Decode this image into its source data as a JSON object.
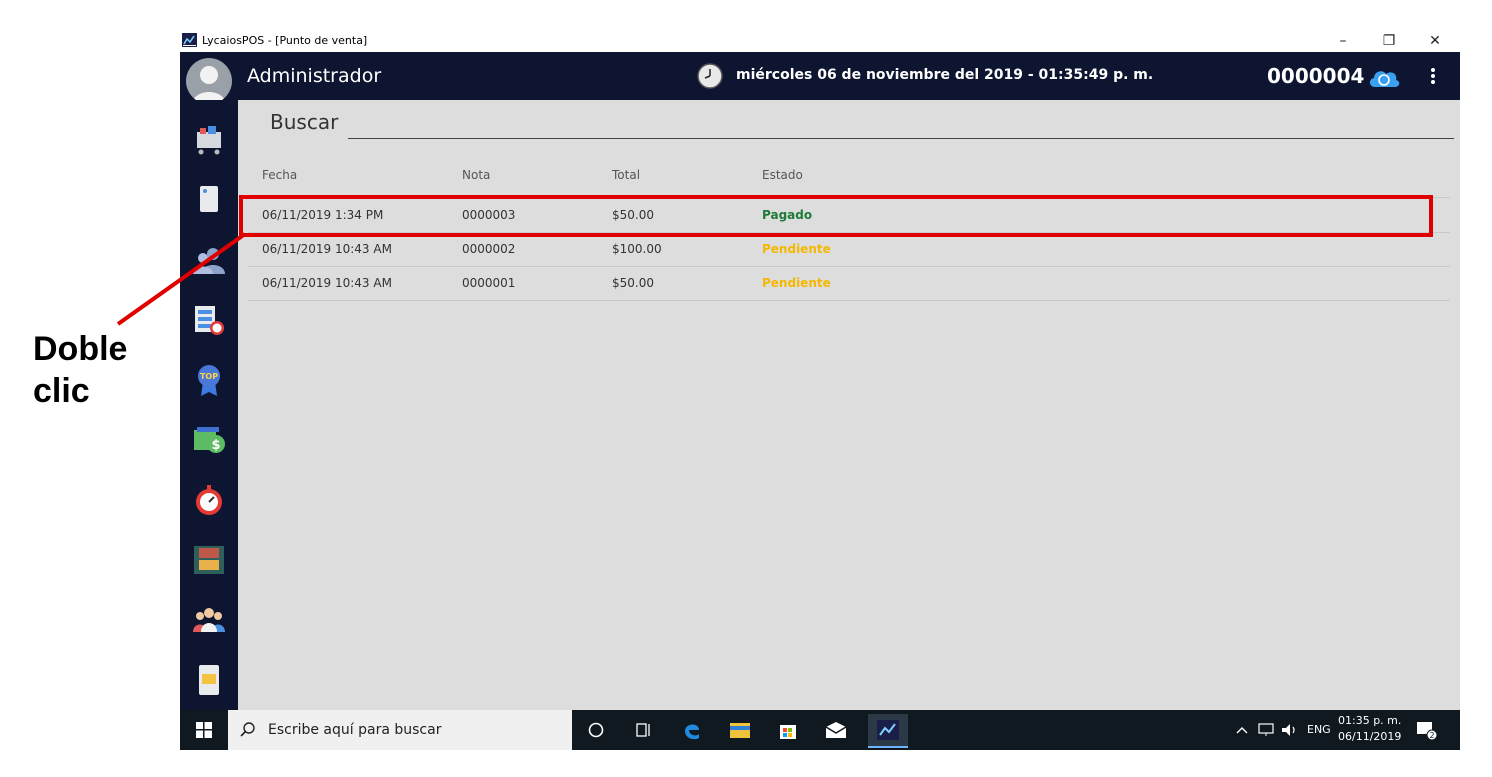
{
  "annotation": {
    "line1": "Doble",
    "line2": "clic"
  },
  "window": {
    "title": "LycaiosPOS - [Punto de venta]",
    "minimize": "–",
    "restore": "❐",
    "close": "✕"
  },
  "header": {
    "user": "Administrador",
    "datetime": "miércoles 06 de noviembre del 2019 - 01:35:49 p. m.",
    "sale_number": "0000004"
  },
  "search": {
    "label": "Buscar",
    "value": ""
  },
  "table": {
    "headers": [
      "Fecha",
      "Nota",
      "Total",
      "Estado"
    ],
    "rows": [
      {
        "fecha": "06/11/2019 1:34 PM",
        "nota": "0000003",
        "total": "$50.00",
        "estado": "Pagado"
      },
      {
        "fecha": "06/11/2019 10:43 AM",
        "nota": "0000002",
        "total": "$100.00",
        "estado": "Pendiente"
      },
      {
        "fecha": "06/11/2019 10:43 AM",
        "nota": "0000001",
        "total": "$50.00",
        "estado": "Pendiente"
      }
    ]
  },
  "status_colors": {
    "Pagado": "#1e7b3a",
    "Pendiente": "#f5b800"
  },
  "sidebar_icons": [
    "shopping-cart-icon",
    "notebook-icon",
    "customers-icon",
    "schedule-list-icon",
    "top-badge-icon",
    "money-icon",
    "stopwatch-icon",
    "warehouse-icon",
    "team-icon",
    "mobile-report-icon"
  ],
  "taskbar": {
    "search_placeholder": "Escribe aquí para buscar",
    "lang": "ENG",
    "time": "01:35 p. m.",
    "date": "06/11/2019",
    "notifications": "2"
  },
  "colors": {
    "highlight": "#e00000",
    "navbar": "#0d1530",
    "content_bg": "#dddddd"
  }
}
